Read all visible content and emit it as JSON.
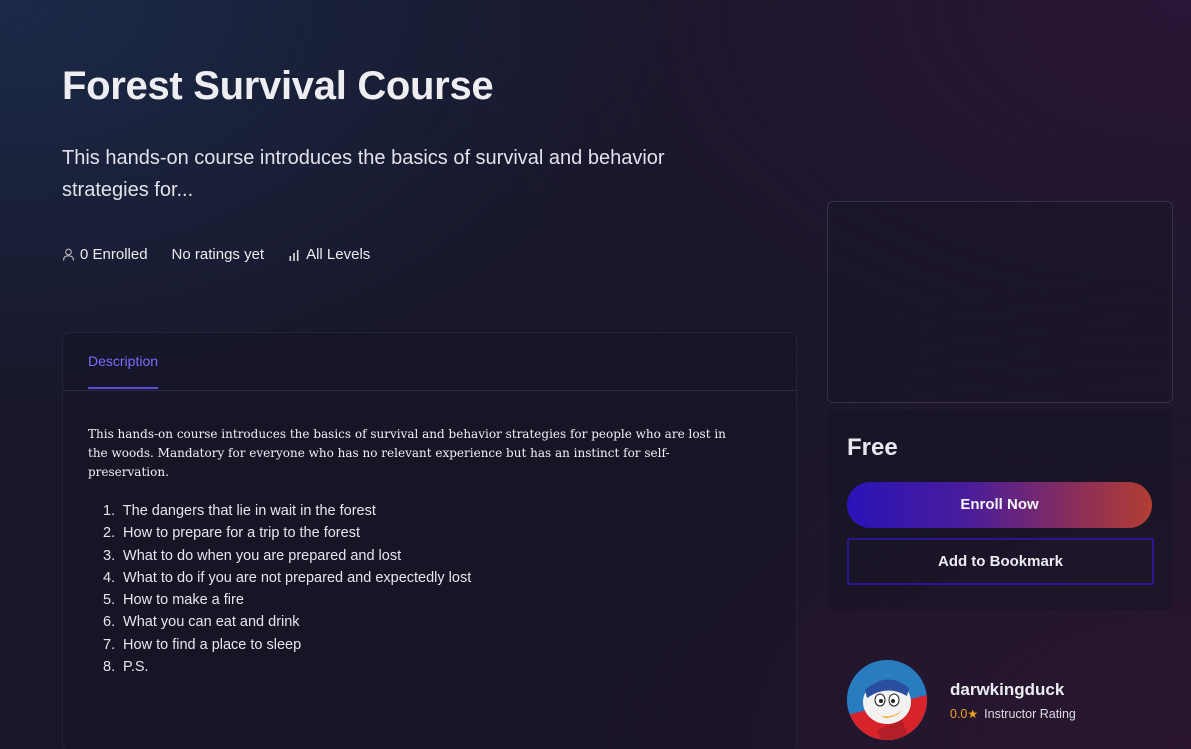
{
  "course": {
    "title": "Forest Survival Course",
    "subtitle": "This hands-on course introduces the basics of survival and behavior strategies for..."
  },
  "meta": {
    "enrolled": "0 Enrolled",
    "ratings": "No ratings yet",
    "level": "All Levels"
  },
  "tabs": [
    {
      "label": "Description",
      "active": true
    }
  ],
  "description": {
    "text": "This hands-on course introduces the basics of survival and behavior strategies for people who are lost in the woods. Mandatory for everyone who has no relevant experience but has an instinct for self-preservation.",
    "steps": [
      "The dangers that lie in wait in the forest",
      "How to prepare for a trip to the forest",
      "What to do when you are prepared and lost",
      "What to do if you are not prepared and expectedly lost",
      "How to make a fire",
      "What you can eat and drink",
      "How to find a place to sleep",
      "P.S."
    ]
  },
  "pricing": {
    "price": "Free",
    "enroll_label": "Enroll Now",
    "bookmark_label": "Add to Bookmark"
  },
  "instructor": {
    "name": "darwkingduck",
    "rating": "0.0",
    "rating_label": "Instructor Rating"
  },
  "colors": {
    "accent": "#5b4ae0",
    "star": "#f0a21b"
  },
  "icons": {
    "enrolled": "user-icon",
    "level": "bar-chart-icon",
    "star": "star-icon"
  }
}
